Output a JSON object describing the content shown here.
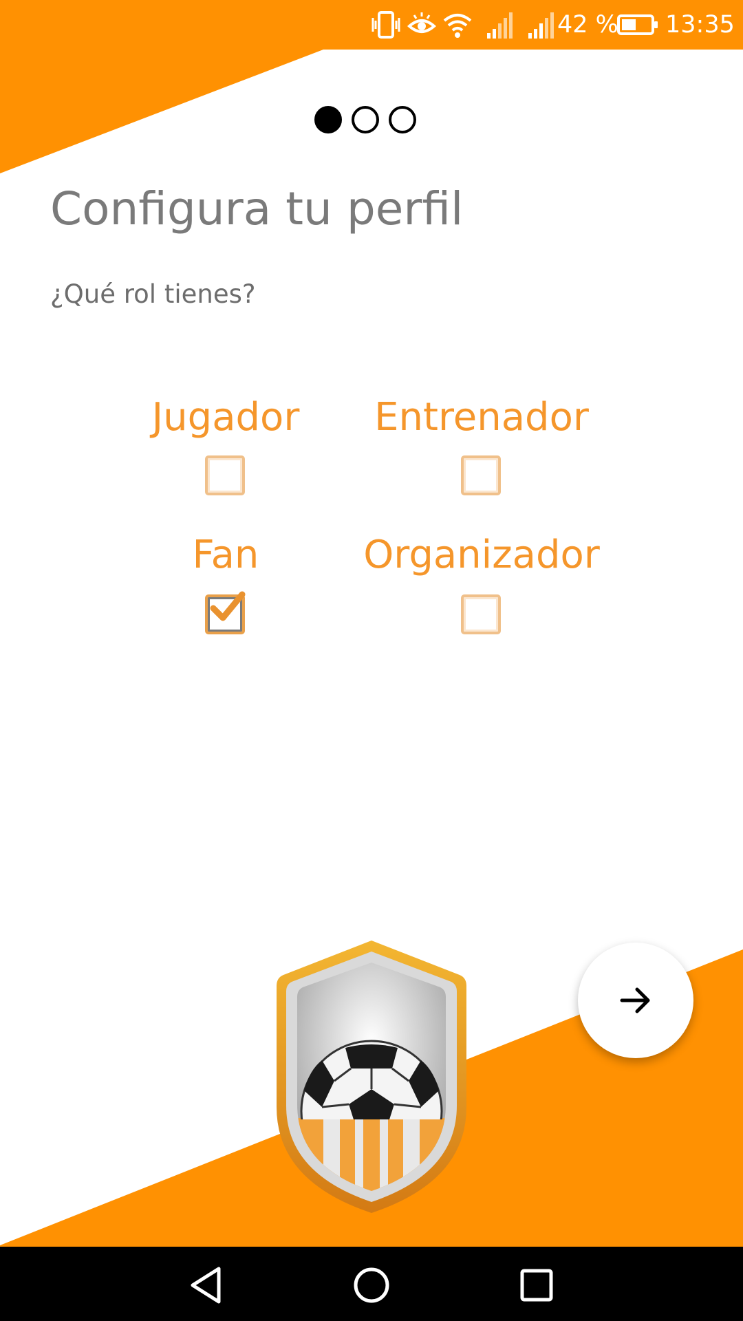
{
  "status_bar": {
    "battery_percent": "42 %",
    "time": "13:35",
    "icons": [
      "vibrate-icon",
      "eye-comfort-icon",
      "wifi-icon",
      "signal-icon",
      "signal-icon",
      "battery-icon"
    ]
  },
  "pager": {
    "total": 3,
    "active_index": 0
  },
  "header": {
    "title": "Configura tu perfil",
    "question": "¿Qué rol tienes?"
  },
  "roles": [
    {
      "label": "Jugador",
      "checked": false
    },
    {
      "label": "Entrenador",
      "checked": false
    },
    {
      "label": "Fan",
      "checked": true
    },
    {
      "label": "Organizador",
      "checked": false
    }
  ],
  "actions": {
    "next_icon": "arrow-right-icon"
  },
  "nav_bar": {
    "buttons": [
      "back-icon",
      "home-icon",
      "recents-icon"
    ]
  },
  "colors": {
    "accent": "#ff9102",
    "role_label": "#f5962b",
    "title": "#7a7a7a"
  }
}
